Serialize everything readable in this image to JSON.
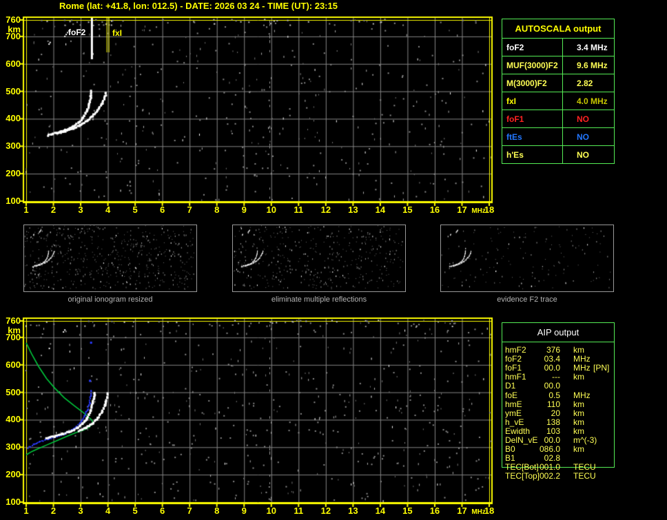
{
  "header": {
    "title": "Rome (lat: +41.8, lon: 012.5) - DATE: 2026 03 24 - TIME (UT): 23:15"
  },
  "autoscala_panel": {
    "title": "AUTOSCALA output",
    "rows": [
      {
        "param": "foF2",
        "value": "3.4 MHz",
        "param_color": "#ffffff",
        "value_color": "#ffffff"
      },
      {
        "param": "MUF(3000)F2",
        "value": "9.6 MHz",
        "param_color": "#ffff55",
        "value_color": "#ffff55"
      },
      {
        "param": "M(3000)F2",
        "value": "2.82",
        "param_color": "#ffff55",
        "value_color": "#ffff55"
      },
      {
        "param": "fxI",
        "value": "4.0 MHz",
        "param_color": "#ffff00",
        "value_color": "#c8c800"
      },
      {
        "param": "foF1",
        "value": "NO",
        "param_color": "#ff2222",
        "value_color": "#ff2222"
      },
      {
        "param": "ftEs",
        "value": "NO",
        "param_color": "#2277ff",
        "value_color": "#2277ff"
      },
      {
        "param": "h'Es",
        "value": "NO",
        "param_color": "#ffff55",
        "value_color": "#ffff55"
      }
    ]
  },
  "aip_panel": {
    "title": "AIP output",
    "rows": [
      {
        "param": "hmF2",
        "value": "376",
        "unit": "km",
        "note": ""
      },
      {
        "param": "foF2",
        "value": "03.4",
        "unit": "MHz",
        "note": ""
      },
      {
        "param": "foF1",
        "value": "00.0",
        "unit": "MHz",
        "note": "[PN]"
      },
      {
        "param": "hmF1",
        "value": "---",
        "unit": "km",
        "note": ""
      },
      {
        "param": "D1",
        "value": "00.0",
        "unit": "",
        "note": ""
      },
      {
        "param": "foE",
        "value": "0.5",
        "unit": "MHz",
        "note": ""
      },
      {
        "param": "hmE",
        "value": "110",
        "unit": "km",
        "note": ""
      },
      {
        "param": "ymE",
        "value": "20",
        "unit": "km",
        "note": ""
      },
      {
        "param": "h_vE",
        "value": "138",
        "unit": "km",
        "note": ""
      },
      {
        "param": "Ewidth",
        "value": "103",
        "unit": "km",
        "note": ""
      },
      {
        "param": "DelN_vE",
        "value": "00.0",
        "unit": "m^(-3)",
        "note": ""
      },
      {
        "param": "B0",
        "value": "086.0",
        "unit": "km",
        "note": ""
      },
      {
        "param": "B1",
        "value": "02.8",
        "unit": "",
        "note": ""
      },
      {
        "param": "TEC[Bot]",
        "value": "001.0",
        "unit": "TECU",
        "note": ""
      },
      {
        "param": "TEC[Top]",
        "value": "002.2",
        "unit": "TECU",
        "note": ""
      }
    ]
  },
  "thumbnails": [
    {
      "caption": "original ionogram resized"
    },
    {
      "caption": "eliminate multiple reflections"
    },
    {
      "caption": "evidence F2 trace"
    }
  ],
  "colors": {
    "accent_yellow": "#ffff00",
    "pale_yellow": "#ffff55",
    "table_green": "#55ee55",
    "grid_gray": "#878787",
    "noise_gray": "#8a8a8a",
    "trace_white": "#ffffff",
    "profile_green": "#00c83c",
    "restored_blue": "#2a3bff",
    "status_red": "#ff2222",
    "status_blue": "#2277ff",
    "caption_gray": "#b4b4b4"
  },
  "chart_data": {
    "top_ionogram": {
      "type": "scatter",
      "xlabel": "MHz",
      "ylabel": "km",
      "x_unit": "MHz",
      "y_unit": "km",
      "xlim": [
        1,
        18
      ],
      "ylim": [
        100,
        760
      ],
      "x_ticks": [
        1,
        2,
        3,
        4,
        5,
        6,
        7,
        8,
        9,
        10,
        11,
        12,
        13,
        14,
        15,
        16,
        17,
        18
      ],
      "y_ticks": [
        760,
        700,
        600,
        500,
        400,
        300,
        200,
        100
      ],
      "grid": true,
      "markers": [
        {
          "name": "foF2",
          "freq_mhz": 3.4,
          "color": "#ffffff",
          "side": "left"
        },
        {
          "name": "fxI",
          "freq_mhz": 4.0,
          "color": "#ffff00",
          "side": "right"
        }
      ],
      "series": [
        {
          "name": "ordinary_trace",
          "color": "#ffffff",
          "points": [
            [
              1.75,
              343
            ],
            [
              1.95,
              349
            ],
            [
              2.2,
              356
            ],
            [
              2.45,
              364
            ],
            [
              2.7,
              375
            ],
            [
              2.9,
              390
            ],
            [
              3.05,
              408
            ],
            [
              3.18,
              430
            ],
            [
              3.27,
              455
            ],
            [
              3.33,
              480
            ],
            [
              3.36,
              505
            ]
          ]
        },
        {
          "name": "extraordinary_trace",
          "color": "#ffffff",
          "points": [
            [
              2.1,
              349
            ],
            [
              2.4,
              358
            ],
            [
              2.7,
              369
            ],
            [
              2.95,
              381
            ],
            [
              3.2,
              396
            ],
            [
              3.4,
              414
            ],
            [
              3.58,
              434
            ],
            [
              3.73,
              456
            ],
            [
              3.85,
              480
            ],
            [
              3.9,
              500
            ]
          ]
        },
        {
          "name": "second_hop_fragments",
          "color": "#ffffff",
          "points": [
            [
              1.84,
              672
            ],
            [
              1.88,
              678
            ],
            [
              2.42,
              700
            ],
            [
              2.47,
              707
            ],
            [
              2.52,
              714
            ],
            [
              2.58,
              721
            ]
          ]
        }
      ]
    },
    "bottom_ionogram": {
      "type": "scatter",
      "xlabel": "MHz",
      "ylabel": "km",
      "x_unit": "MHz",
      "y_unit": "km",
      "xlim": [
        1,
        18
      ],
      "ylim": [
        100,
        760
      ],
      "x_ticks": [
        1,
        2,
        3,
        4,
        5,
        6,
        7,
        8,
        9,
        10,
        11,
        12,
        13,
        14,
        15,
        16,
        17,
        18
      ],
      "y_ticks": [
        760,
        700,
        600,
        500,
        400,
        300,
        200,
        100
      ],
      "grid": true,
      "series": [
        {
          "name": "measured_ordinary_trace",
          "color": "#ffffff",
          "points": [
            [
              1.7,
              335
            ],
            [
              2.0,
              343
            ],
            [
              2.3,
              352
            ],
            [
              2.6,
              362
            ],
            [
              2.85,
              374
            ],
            [
              3.05,
              390
            ],
            [
              3.2,
              410
            ],
            [
              3.32,
              435
            ],
            [
              3.4,
              462
            ],
            [
              3.46,
              488
            ],
            [
              3.48,
              502
            ]
          ]
        },
        {
          "name": "measured_extraordinary_trace",
          "color": "#ffffff",
          "points": [
            [
              2.9,
              362
            ],
            [
              3.15,
              374
            ],
            [
              3.4,
              390
            ],
            [
              3.6,
              410
            ],
            [
              3.75,
              433
            ],
            [
              3.86,
              458
            ],
            [
              3.93,
              482
            ],
            [
              3.96,
              500
            ]
          ]
        },
        {
          "name": "restored_trace",
          "color": "#2a3bff",
          "points": [
            [
              1.05,
              300
            ],
            [
              1.25,
              312
            ],
            [
              1.5,
              323
            ],
            [
              1.8,
              333
            ],
            [
              2.1,
              341
            ],
            [
              2.4,
              351
            ],
            [
              2.65,
              364
            ],
            [
              2.85,
              379
            ],
            [
              3.0,
              396
            ],
            [
              3.12,
              415
            ],
            [
              3.22,
              438
            ],
            [
              3.3,
              463
            ],
            [
              3.34,
              488
            ],
            [
              3.36,
              510
            ]
          ]
        },
        {
          "name": "restored_isolated_points",
          "color": "#2a3bff",
          "points": [
            [
              3.33,
              543
            ],
            [
              3.37,
              682
            ]
          ]
        },
        {
          "name": "second_hop_fragments",
          "color": "#ffffff",
          "points": [
            [
              1.85,
              660
            ],
            [
              2.37,
              720
            ],
            [
              2.42,
              727
            ]
          ]
        },
        {
          "name": "electron_density_profile",
          "color": "#00c83c",
          "points": [
            [
              1.0,
              680
            ],
            [
              1.2,
              640
            ],
            [
              1.45,
              595
            ],
            [
              1.75,
              550
            ],
            [
              2.05,
              515
            ],
            [
              2.4,
              480
            ],
            [
              2.75,
              452
            ],
            [
              3.05,
              430
            ],
            [
              3.25,
              413
            ],
            [
              3.4,
              400
            ],
            [
              3.44,
              393
            ],
            [
              3.42,
              385
            ],
            [
              3.3,
              372
            ],
            [
              3.1,
              362
            ],
            [
              2.8,
              352
            ],
            [
              2.45,
              338
            ],
            [
              2.1,
              323
            ],
            [
              1.75,
              308
            ],
            [
              1.45,
              295
            ],
            [
              1.2,
              284
            ],
            [
              1.0,
              272
            ]
          ]
        }
      ]
    }
  }
}
